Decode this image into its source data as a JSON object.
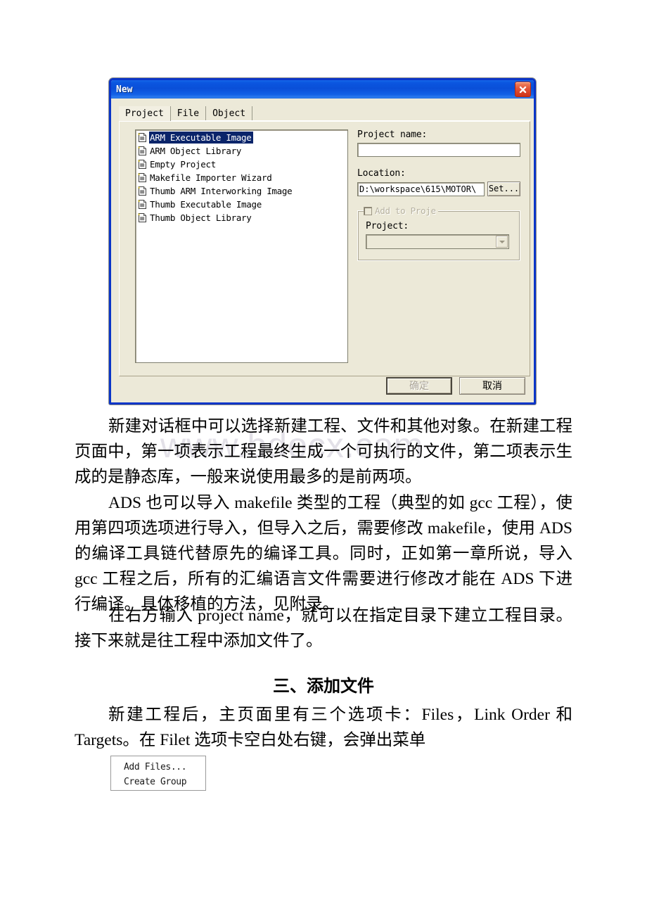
{
  "page": {
    "watermark": "www.bdocx.com",
    "background": "#ffffff"
  },
  "dialog": {
    "title": "New",
    "close_icon": "close-icon",
    "accent_titlebar": "#0a4fd8",
    "face_color": "#ece9d8",
    "selection_color": "#0a246a",
    "tabs": [
      {
        "label": "Project",
        "active": true
      },
      {
        "label": "File",
        "active": false
      },
      {
        "label": "Object",
        "active": false
      }
    ],
    "list": {
      "items": [
        {
          "label": "ARM Executable Image",
          "selected": true
        },
        {
          "label": "ARM Object Library",
          "selected": false
        },
        {
          "label": "Empty Project",
          "selected": false
        },
        {
          "label": "Makefile Importer Wizard",
          "selected": false
        },
        {
          "label": "Thumb ARM Interworking Image",
          "selected": false
        },
        {
          "label": "Thumb Executable Image",
          "selected": false
        },
        {
          "label": "Thumb Object Library",
          "selected": false
        }
      ]
    },
    "fields": {
      "project_name_label": "Project name:",
      "project_name_value": "",
      "location_label": "Location:",
      "location_value": "D:\\workspace\\615\\MOTOR\\",
      "set_button": "Set...",
      "group_legend": "Add to Proje",
      "group_project_label": "Project:",
      "group_project_value": ""
    },
    "buttons": {
      "ok": "确定",
      "cancel": "取消"
    }
  },
  "document": {
    "paragraph1": "新建对话框中可以选择新建工程、文件和其他对象。在新建工程页面中，第一项表示工程最终生成一个可执行的文件，第二项表示生成的是静态库，一般来说使用最多的是前两项。",
    "paragraph2": "ADS 也可以导入 makefile 类型的工程（典型的如 gcc 工程），使用第四项选项进行导入，但导入之后，需要修改 makefile，使用 ADS 的编译工具链代替原先的编译工具。同时，正如第一章所说，导入 gcc 工程之后，所有的汇编语言文件需要进行修改才能在 ADS 下进行编译。具体移植的方法，见附录。",
    "paragraph3": "在右方输入 project name，就可以在指定目录下建立工程目录。接下来就是往工程中添加文件了。",
    "heading": "三、添加文件",
    "paragraph4": "新建工程后，主页面里有三个选项卡：Files，Link Order 和 Targets。在 Filet 选项卡空白处右键，会弹出菜单"
  },
  "context_menu": {
    "items": [
      {
        "label": "Add Files..."
      },
      {
        "label": "Create Group"
      }
    ]
  }
}
